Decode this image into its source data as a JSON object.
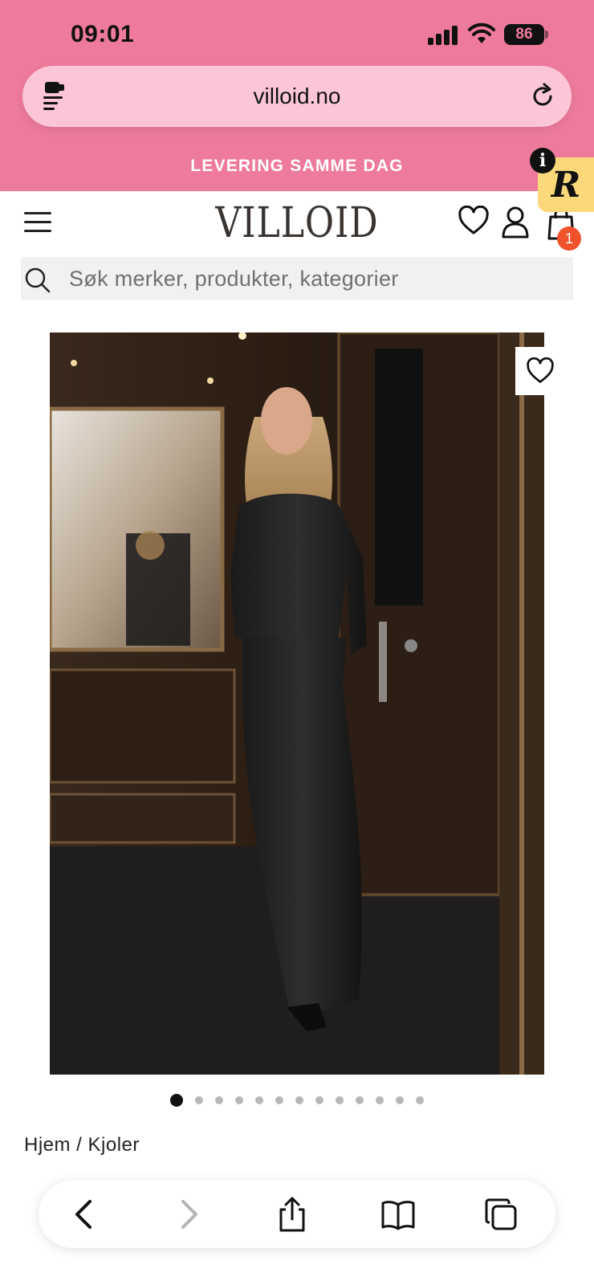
{
  "status_bar": {
    "time": "09:01",
    "battery": "86"
  },
  "browser": {
    "url": "villoid.no"
  },
  "promo_banner": {
    "text": "LEVERING SAMME DAG"
  },
  "badge": {
    "letter": "R",
    "info": "i"
  },
  "header": {
    "logo": "VILLOID",
    "cart_count": "1"
  },
  "search": {
    "placeholder": "Søk merker, produkter, kategorier"
  },
  "gallery": {
    "total_images": 13,
    "active_index": 0
  },
  "breadcrumb": {
    "text": "Hjem / Kjoler"
  },
  "colors": {
    "brand_pink": "#ee7a9c",
    "url_bar_pink": "#fcc6d8",
    "cart_badge": "#f0522b",
    "badge_yellow": "#fbd97a"
  },
  "icons": [
    "extension-icon",
    "reload-icon",
    "menu-icon",
    "heart-icon",
    "user-icon",
    "shopping-bag-icon",
    "search-icon",
    "back-icon",
    "forward-icon",
    "share-icon",
    "bookmarks-icon",
    "tabs-icon"
  ]
}
